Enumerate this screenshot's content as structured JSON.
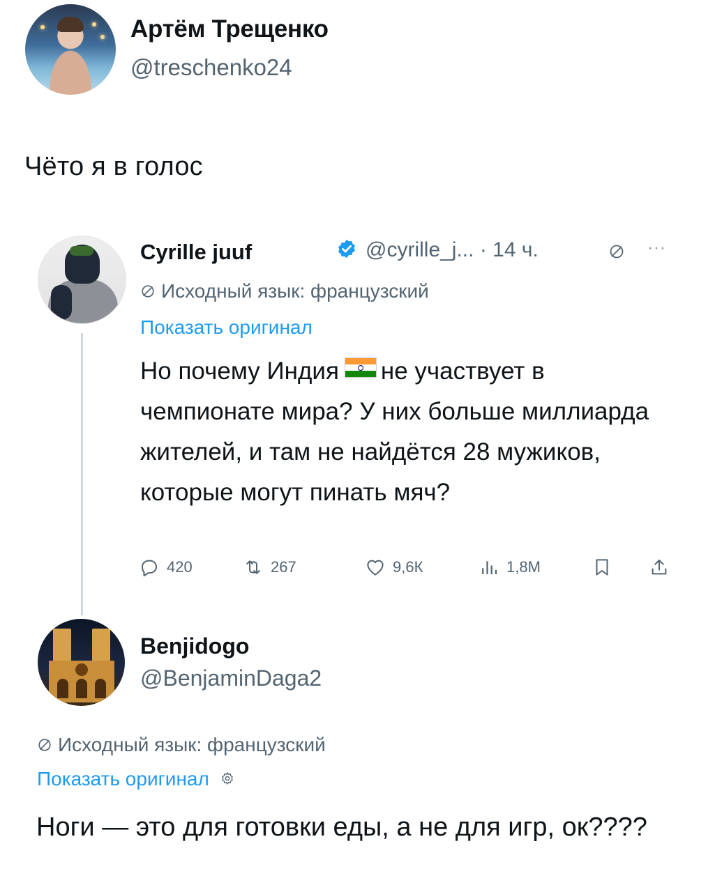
{
  "top_tweet": {
    "author_name": "Артём Трещенко",
    "author_handle": "@treschenko24",
    "text": "Чёто я в голос"
  },
  "quoted_tweet": {
    "author_name": "Cyrille juuf",
    "author_handle_meta": "@cyrille_j... · 14 ч.",
    "more_label": "···",
    "translation_note": "Исходный язык: французский",
    "show_original_label": "Показать оригинал",
    "text_before_flag": "Но почему Индия",
    "flag_icon": "india-flag-icon",
    "text_after_flag": "не участвует в чемпионате мира? У них больше миллиарда жителей, и там не найдётся 28 мужиков, которые могут пинать мяч?",
    "actions": {
      "reply_count": "420",
      "retweet_count": "267",
      "like_count": "9,6К",
      "views_count": "1,8М"
    }
  },
  "reply_tweet": {
    "author_name": "Benjidogo",
    "author_handle": "@BenjaminDaga2",
    "translation_note": "Исходный язык: французский",
    "show_original_label": "Показать оригинал",
    "text": "Ноги — это для готовки еды, а не для игр, ок????"
  },
  "colors": {
    "text_primary": "#0f1419",
    "text_secondary": "#536471",
    "link_blue": "#1d9bf0",
    "thread_line": "#cfd9de"
  }
}
